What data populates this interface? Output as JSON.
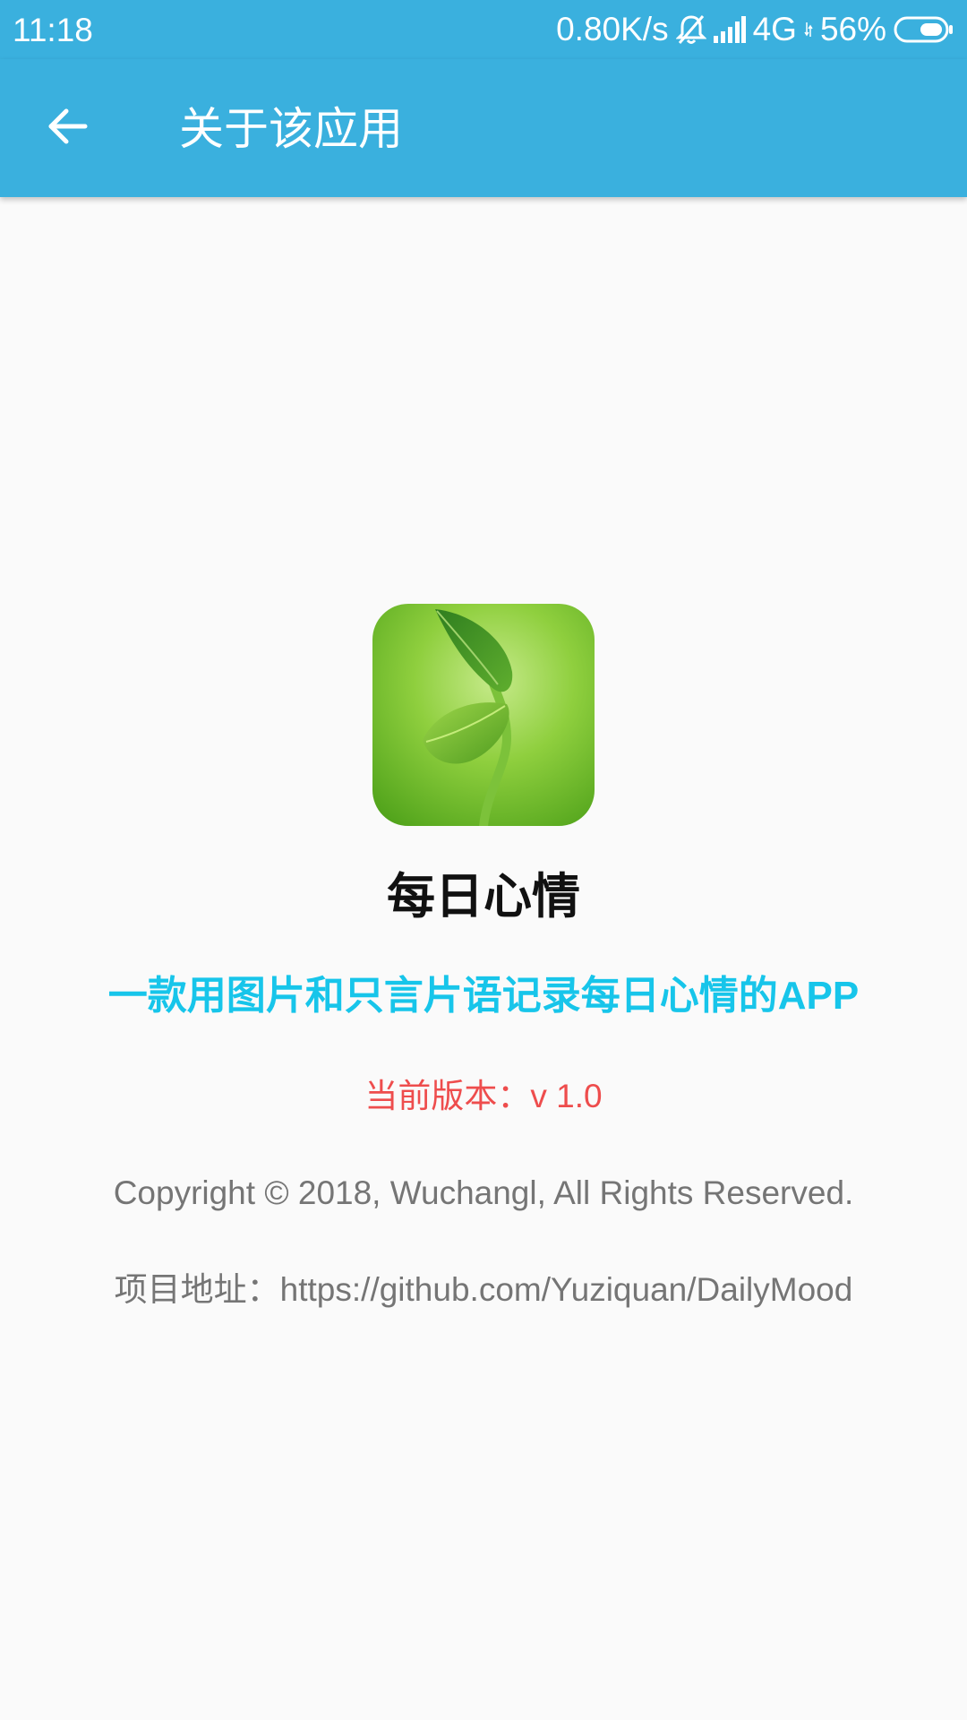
{
  "status_bar": {
    "time": "11:18",
    "network_speed": "0.80K/s",
    "network_type": "4G",
    "battery": "56%",
    "icons": [
      "bell-off-icon",
      "signal-icon",
      "battery-icon"
    ]
  },
  "app_bar": {
    "title": "关于该应用",
    "back_icon": "arrow-left-icon",
    "background_color": "#3ab0de"
  },
  "about": {
    "icon": "sprout-leaf-icon",
    "name": "每日心情",
    "tagline": "一款用图片和只言片语记录每日心情的APP",
    "version": "当前版本：v 1.0",
    "copyright": "Copyright © 2018, Wuchangl, All Rights Reserved.",
    "project_url": "项目地址：https://github.com/Yuziquan/DailyMood"
  },
  "colors": {
    "accent": "#3ab0de",
    "tagline": "#17c5ea",
    "version": "#ee4d4d",
    "secondary_text": "#757575",
    "background": "#fafafa"
  }
}
